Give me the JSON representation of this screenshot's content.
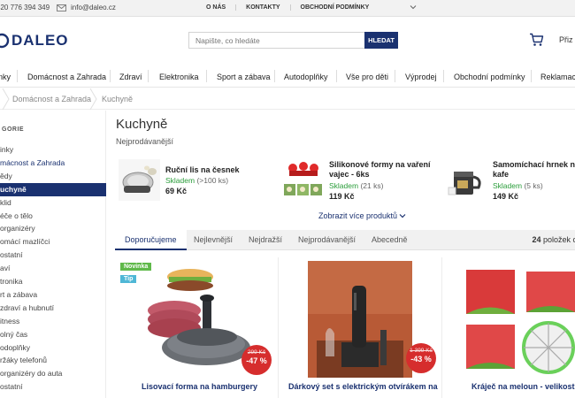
{
  "topbar": {
    "phone": "420 776 394 349",
    "email": "info@daleo.cz",
    "links": [
      "O NÁS",
      "KONTAKTY",
      "OBCHODNÍ PODMÍNKY"
    ]
  },
  "header": {
    "logo": "DALEO",
    "search_placeholder": "Napište, co hledáte",
    "search_button": "HLEDAT",
    "cart_label": "Přiz"
  },
  "nav": [
    "nky",
    "Domácnost a Zahrada",
    "Zdraví",
    "Elektronika",
    "Sport a zábava",
    "Autodoplňky",
    "Vše pro děti",
    "Výprodej",
    "Obchodní podmínky",
    "Reklamace"
  ],
  "breadcrumb": [
    "Domácnost a Zahrada",
    "Kuchyně"
  ],
  "sidebar": {
    "heading": "GORIE",
    "items": [
      {
        "label": "inky",
        "state": "normal"
      },
      {
        "label": "mácnost a Zahrada",
        "state": "blue"
      },
      {
        "label": "ědy",
        "state": "normal"
      },
      {
        "label": "uchyně",
        "state": "active"
      },
      {
        "label": "klid",
        "state": "normal"
      },
      {
        "label": "éče o tělo",
        "state": "normal"
      },
      {
        "label": "organizéry",
        "state": "normal"
      },
      {
        "label": "omácí mazlíčci",
        "state": "normal"
      },
      {
        "label": "ostatní",
        "state": "normal"
      },
      {
        "label": "aví",
        "state": "normal"
      },
      {
        "label": "tronika",
        "state": "normal"
      },
      {
        "label": "rt a zábava",
        "state": "normal"
      },
      {
        "label": "zdraví a hubnutí",
        "state": "normal"
      },
      {
        "label": "itness",
        "state": "normal"
      },
      {
        "label": "olný čas",
        "state": "normal"
      },
      {
        "label": "odoplňky",
        "state": "normal"
      },
      {
        "label": "ržáky telefonů",
        "state": "normal"
      },
      {
        "label": "organizéry do auta",
        "state": "normal"
      },
      {
        "label": "ostatní",
        "state": "normal"
      }
    ]
  },
  "page": {
    "title": "Kuchyně",
    "bestsellers_heading": "Nejprodávanější",
    "show_more": "Zobrazit více produktů"
  },
  "bestsellers": [
    {
      "name": "Ruční lis na česnek",
      "stock": "Skladem",
      "qty": "(>100 ks)",
      "price": "69 Kč"
    },
    {
      "name": "Silikonové formy na vaření vajec - 6ks",
      "stock": "Skladem",
      "qty": "(21 ks)",
      "price": "119 Kč"
    },
    {
      "name": "Samomíchací hrnek na kafe",
      "stock": "Skladem",
      "qty": "(5 ks)",
      "price": "149 Kč"
    }
  ],
  "sort_tabs": [
    "Doporučujeme",
    "Nejlevnější",
    "Nejdražší",
    "Nejprodávanější",
    "Abecedně"
  ],
  "item_count": {
    "number": "24",
    "label": "položek c"
  },
  "products": [
    {
      "title": "Lisovací forma na hamburgery",
      "badges": [
        "Novinka",
        "Tip"
      ],
      "old_price": "299 Kč",
      "discount": "-47 %"
    },
    {
      "title": "Dárkový set s elektrickým otvírákem na",
      "old_price": "1 399 Kč",
      "discount": "-43 %"
    },
    {
      "title": "Kráječ na meloun - velikost L"
    }
  ],
  "colors": {
    "brand": "#1a3170",
    "stock": "#2a9d3a",
    "sale": "#d62d2d",
    "new_badge": "#5fb94a",
    "tip_badge": "#4fb7d6"
  }
}
